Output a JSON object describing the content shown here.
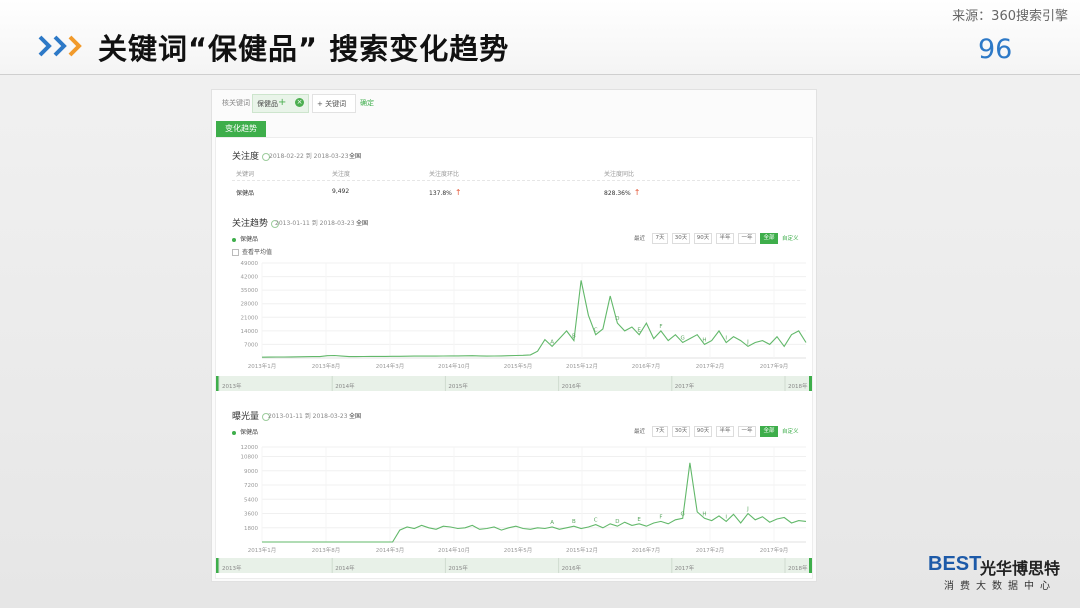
{
  "slide": {
    "source": "来源：360搜索引擎",
    "title": "关键词“保健品” 搜索变化趋势",
    "page_number": "96"
  },
  "topbar": {
    "related_label": "核关键词",
    "keyword": "保健品",
    "plus": "+",
    "close": "×",
    "add_keyword": "+ 关键词",
    "confirm": "确定"
  },
  "tab_label": "变化趋势",
  "attention": {
    "title": "关注度",
    "date_range": "2018-02-22 到 2018-03-23",
    "region": "全国",
    "headers": [
      "关键词",
      "关注度",
      "关注度环比",
      "关注度同比"
    ],
    "row": {
      "keyword": "保健品",
      "value": "9,492",
      "mom": "137.8%",
      "yoy": "828.36%",
      "arrow": "↑"
    }
  },
  "range_buttons": {
    "label": "最近",
    "options": [
      "7天",
      "30天",
      "90天",
      "半年",
      "一年",
      "全部"
    ],
    "active": "全部",
    "custom": "自定义"
  },
  "trend": {
    "title": "关注趋势",
    "date_range": "2013-01-11 到 2018-03-23",
    "region": "全国",
    "series_label": "保健品",
    "checkbox_label": "查看平均值"
  },
  "exposure": {
    "title": "曝光量",
    "date_range": "2013-01-11 到 2018-03-23",
    "region": "全国",
    "series_label": "保健品"
  },
  "chart_data": [
    {
      "type": "line",
      "name": "关注趋势",
      "ylim": [
        0,
        49000
      ],
      "yticks": [
        "49000",
        "42000",
        "35000",
        "28000",
        "21000",
        "14000",
        "7000"
      ],
      "xticks": [
        "2013年1月",
        "2013年8月",
        "2014年3月",
        "2014年10月",
        "2015年5月",
        "2015年12月",
        "2016年7月",
        "2017年2月",
        "2017年9月"
      ],
      "timeline": [
        "2013年",
        "2014年",
        "2015年",
        "2016年",
        "2017年",
        "2018年"
      ],
      "annotations": [
        "A",
        "B",
        "C",
        "D",
        "E",
        "F",
        "G",
        "H",
        "I",
        "J"
      ],
      "series": [
        {
          "name": "保健品",
          "values": [
            400,
            450,
            500,
            500,
            550,
            600,
            650,
            700,
            700,
            1200,
            1300,
            1000,
            700,
            700,
            750,
            800,
            800,
            850,
            900,
            900,
            950,
            1000,
            1000,
            1050,
            1000,
            1050,
            1100,
            1100,
            1150,
            1200,
            1100,
            1000,
            1050,
            1100,
            1200,
            1300,
            1400,
            1600,
            3500,
            9500,
            6000,
            10000,
            14000,
            9000,
            40000,
            22000,
            12000,
            15000,
            32000,
            18000,
            14000,
            16000,
            12000,
            18000,
            10000,
            14000,
            9000,
            12000,
            8000,
            10000,
            12000,
            7000,
            9000,
            14000,
            8000,
            11000,
            9000,
            6000,
            8000,
            9000,
            7000,
            11000,
            6000,
            12000,
            14000,
            8000
          ]
        }
      ],
      "grid": true,
      "legend": "top-left"
    },
    {
      "type": "line",
      "name": "曝光量",
      "ylim": [
        0,
        12000
      ],
      "yticks": [
        "12000",
        "10800",
        "9000",
        "7200",
        "5400",
        "3600",
        "1800"
      ],
      "xticks": [
        "2013年1月",
        "2013年8月",
        "2014年3月",
        "2014年10月",
        "2015年5月",
        "2015年12月",
        "2016年7月",
        "2017年2月",
        "2017年9月"
      ],
      "timeline": [
        "2013年",
        "2014年",
        "2015年",
        "2016年",
        "2017年",
        "2018年"
      ],
      "annotations": [
        "A",
        "B",
        "C",
        "D",
        "E",
        "F",
        "G",
        "H",
        "I",
        "J"
      ],
      "series": [
        {
          "name": "保健品",
          "values": [
            0,
            0,
            0,
            0,
            0,
            0,
            0,
            0,
            0,
            0,
            0,
            0,
            0,
            0,
            0,
            0,
            0,
            0,
            0,
            1500,
            1900,
            1700,
            2100,
            1800,
            1600,
            2000,
            1900,
            1700,
            1800,
            2100,
            1600,
            1700,
            1900,
            1500,
            1800,
            2000,
            1700,
            1600,
            1800,
            1700,
            1900,
            1600,
            1800,
            2000,
            1700,
            1900,
            2200,
            1800,
            2300,
            2000,
            2500,
            2100,
            2300,
            2000,
            2400,
            2600,
            2300,
            2800,
            3000,
            10000,
            3800,
            3000,
            2700,
            3300,
            2600,
            3500,
            2400,
            3600,
            2800,
            3200,
            2500,
            2900,
            3100,
            2400,
            2700,
            2600
          ]
        }
      ],
      "grid": true,
      "legend": "top-left"
    }
  ]
}
